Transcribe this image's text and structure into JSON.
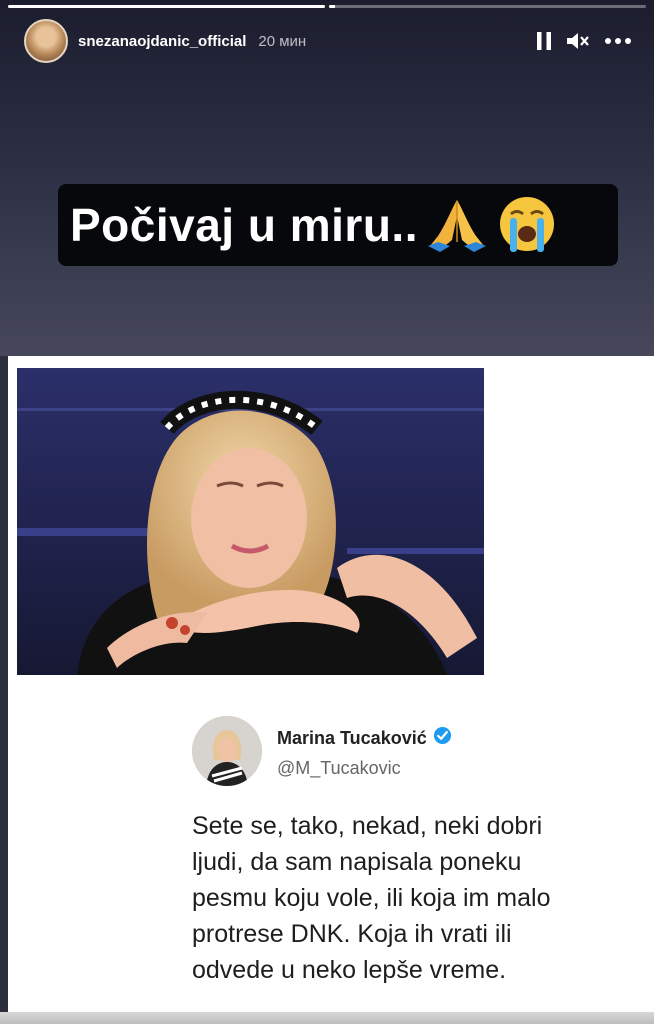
{
  "story": {
    "progress": [
      1.0,
      0.02
    ],
    "username": "snezanaojdanic_official",
    "time": "20 мин",
    "controls": {
      "pause_icon": "pause-icon",
      "mute_icon": "speaker-muted-icon",
      "more_icon": "more-horizontal-icon"
    },
    "caption": {
      "text": "Počivaj u miru..",
      "emojis": [
        "folded-hands-emoji",
        "loudly-crying-face-emoji"
      ]
    }
  },
  "tweet": {
    "name": "Marina Tucaković",
    "verified_icon": "verified-badge-icon",
    "handle": "@M_Tucakovic",
    "lines": [
      "Sete se, tako, nekad, neki dobri",
      "ljudi, da sam napisala poneku",
      "pesmu koju vole, ili koja im malo",
      "protrese DNK. Koja ih vrati ili",
      "odvede u neko lepše vreme."
    ]
  },
  "colors": {
    "story_bg_top": "#1b1d2e",
    "caption_bg": "#07080b",
    "verified_blue": "#1d9bf0"
  }
}
